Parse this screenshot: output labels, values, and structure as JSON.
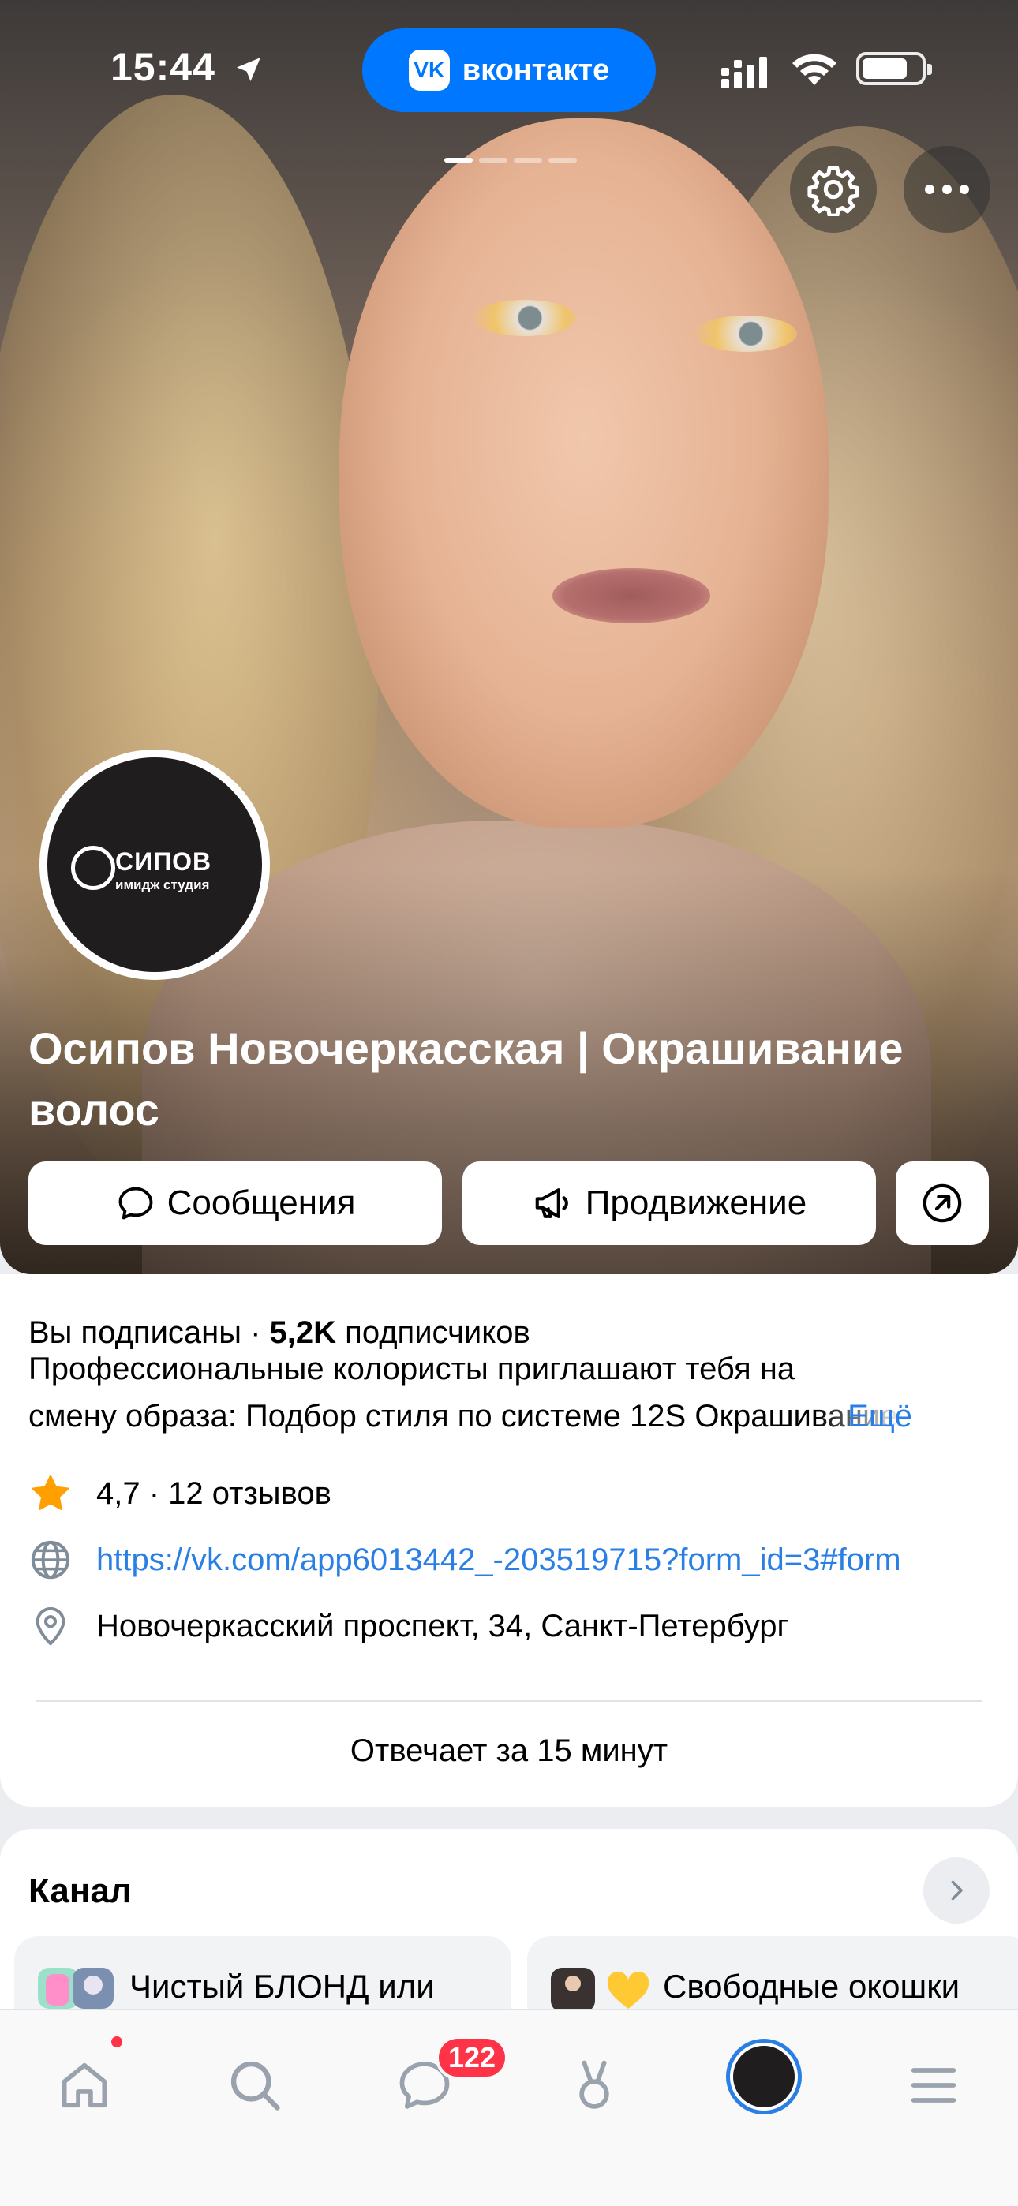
{
  "status_bar": {
    "time": "15:44",
    "app_pill": "вконтакте",
    "app_logo": "VK",
    "icons": [
      "location-arrow-icon",
      "signal-icon",
      "wifi-icon",
      "battery-icon"
    ]
  },
  "cover": {
    "pages_total": 4,
    "active_page": 1,
    "avatar_logo": {
      "main": "СИПОВ",
      "sub": "имидж студия"
    },
    "title": "Осипов Новочеркасская | Окрашивание волос"
  },
  "actions": {
    "messages_label": "Сообщения",
    "promotion_label": "Продвижение"
  },
  "info": {
    "subscribed": "Вы подписаны",
    "separator": " · ",
    "subscribers_count": "5,2K",
    "subscribers_label": "подписчиков",
    "description_line1": "Профессиональные колористы приглашают тебя на",
    "description_line2": "смену образа:  Подбор стиля по системе 12S Окрашивание",
    "more_label": "Ещё",
    "rating": "4,7 · 12 отзывов",
    "link": "https://vk.com/app6013442_-203519715?form_id=3#form",
    "address": "Новочеркасский проспект, 34, Санкт-Петербург",
    "responds": "Отвечает за 15 минут"
  },
  "channel": {
    "title": "Канал",
    "items": [
      {
        "text": "Чистый БЛОНД или"
      },
      {
        "text": "Свободные окошки"
      }
    ]
  },
  "tabbar": {
    "messages_badge": "122",
    "tabs": [
      "home-icon",
      "search-icon",
      "messages-icon",
      "clips-icon",
      "profile-avatar",
      "menu-icon"
    ]
  },
  "colors": {
    "accent": "#0077ff",
    "link": "#2a7fe5",
    "badge": "#ff3347",
    "star": "#ffa000"
  }
}
